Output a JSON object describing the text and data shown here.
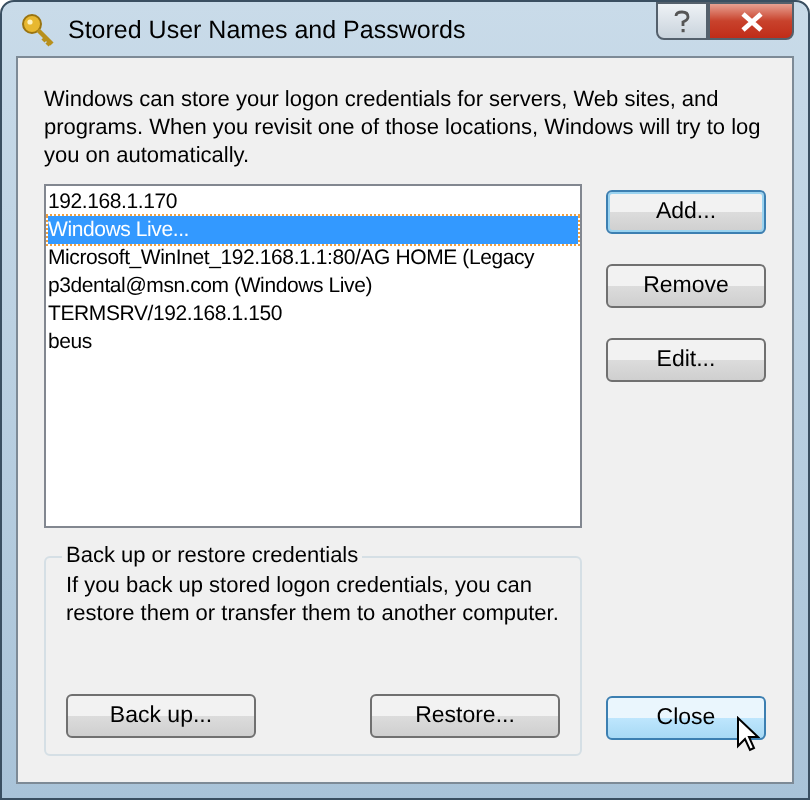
{
  "window": {
    "title": "Stored User Names and Passwords"
  },
  "description": "Windows can store your logon credentials for servers, Web sites, and programs. When you revisit one of those locations, Windows will try to log you on automatically.",
  "credentials": [
    {
      "label": "192.168.1.170",
      "selected": false
    },
    {
      "label": "Windows Live...",
      "selected": true
    },
    {
      "label": "Microsoft_WinInet_192.168.1.1:80/AG HOME (Legacy",
      "selected": false
    },
    {
      "label": "p3dental@msn.com (Windows Live)",
      "selected": false
    },
    {
      "label": "TERMSRV/192.168.1.150",
      "selected": false
    },
    {
      "label": "beus",
      "selected": false
    }
  ],
  "side_buttons": [
    {
      "label": "Add...",
      "default": true
    },
    {
      "label": "Remove",
      "default": false
    },
    {
      "label": "Edit...",
      "default": false
    }
  ],
  "backup_group": {
    "title": "Back up or restore credentials",
    "text": "If you back up stored logon credentials, you can restore them or transfer them to another computer.",
    "buttons": [
      {
        "label": "Back up..."
      },
      {
        "label": "Restore..."
      }
    ]
  },
  "close_button": {
    "label": "Close",
    "hover": true
  }
}
